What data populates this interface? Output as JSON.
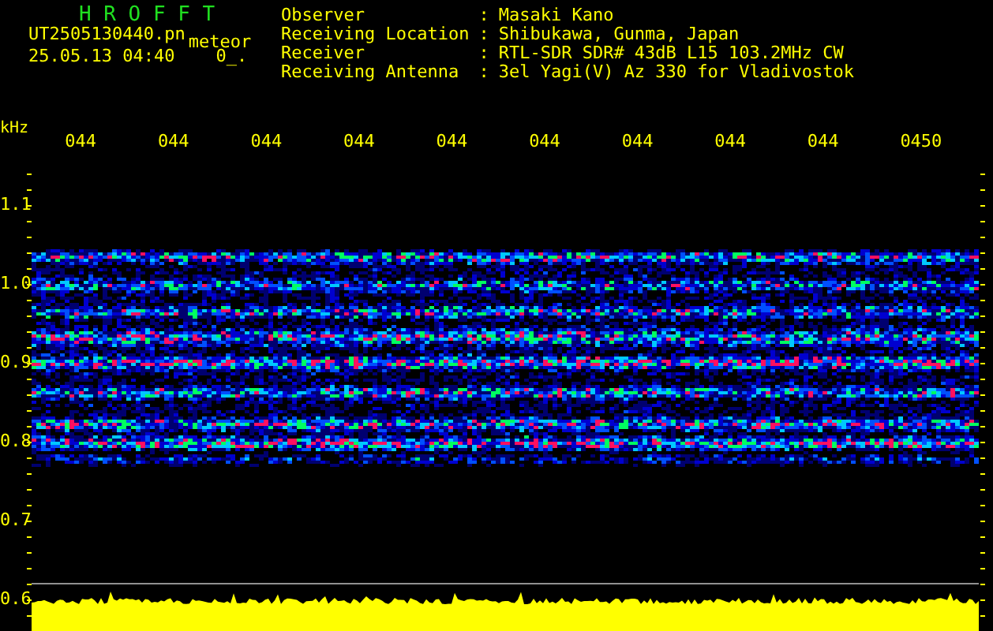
{
  "header": {
    "title": "H R O F F T",
    "filename": "UT2505130440.pn",
    "tag": "meteor",
    "timestamp": "25.05.13 04:40",
    "code": "0_."
  },
  "info": [
    {
      "label": "Observer",
      "separator": ":",
      "value": "Masaki Kano"
    },
    {
      "label": "Receiving Location",
      "separator": ":",
      "value": "Shibukawa, Gunma, Japan"
    },
    {
      "label": "Receiver",
      "separator": ":",
      "value": "RTL-SDR SDR# 43dB L15 103.2MHz CW"
    },
    {
      "label": "Receiving Antenna",
      "separator": ":",
      "value": "3el Yagi(V) Az 330 for Vladivostok"
    }
  ],
  "x_axis": {
    "unit": "kHz",
    "labels": [
      "044",
      "044",
      "044",
      "044",
      "044",
      "044",
      "044",
      "044",
      "044",
      "0450"
    ]
  },
  "y_axis": {
    "labels": [
      "1.1",
      "1.0",
      "0.9",
      "0.8",
      "0.7",
      "0.6"
    ]
  }
}
